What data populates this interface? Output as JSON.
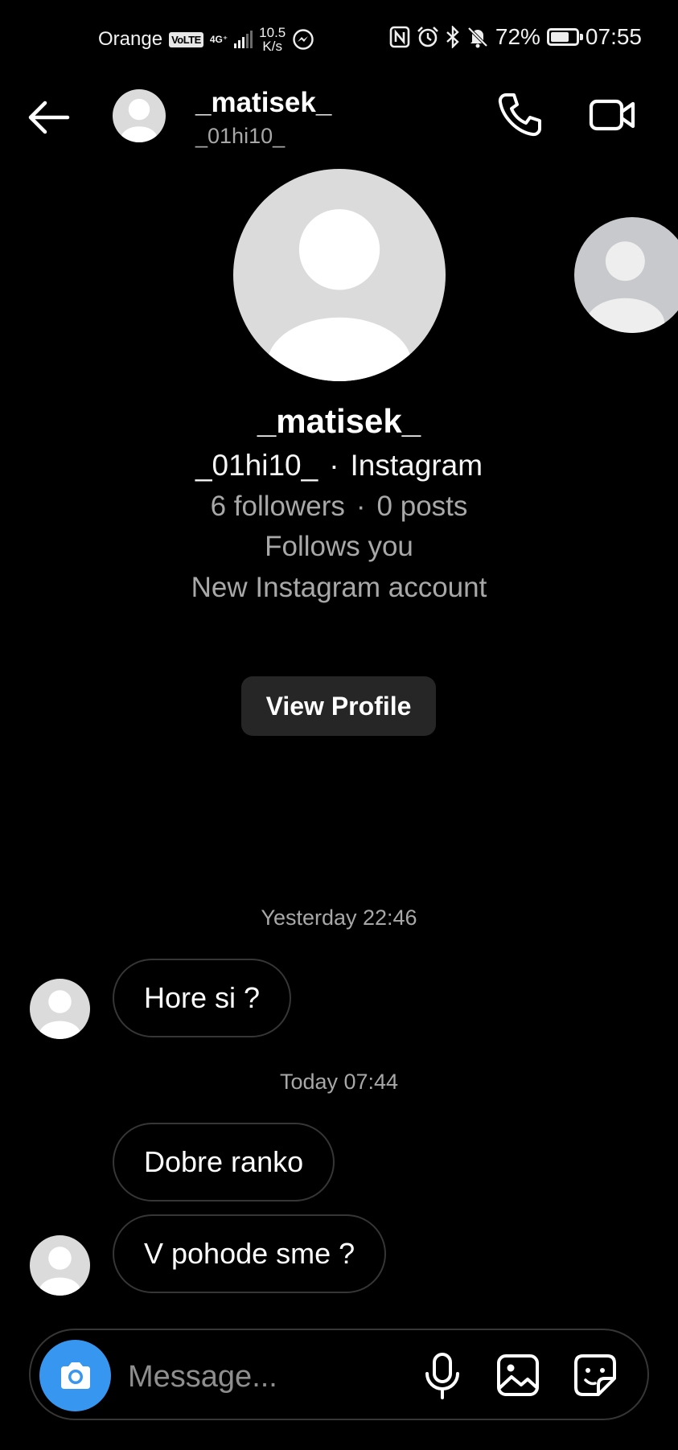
{
  "status_bar": {
    "carrier": "Orange",
    "volte": "VoLTE",
    "network": "4G⁺",
    "speed_value": "10.5",
    "speed_unit": "K/s",
    "battery": "72%",
    "battery_level": 0.72,
    "time": "07:55",
    "icons": [
      "messenger-icon",
      "nfc-icon",
      "alarm-icon",
      "bluetooth-icon",
      "mute-icon",
      "battery-icon"
    ]
  },
  "header": {
    "name": "_matisek_",
    "username": "_01hi10_",
    "icons": [
      "back-arrow-icon",
      "phone-icon",
      "video-camera-icon"
    ]
  },
  "profile": {
    "name": "_matisek_",
    "username": "_01hi10_",
    "platform": "Instagram",
    "followers": "6 followers",
    "posts": "0 posts",
    "follows_you": "Follows you",
    "new_account": "New Instagram account",
    "view_profile_label": "View Profile"
  },
  "messages": {
    "groups": [
      {
        "timestamp": "Yesterday 22:46",
        "items": [
          "Hore si ?"
        ]
      },
      {
        "timestamp": "Today 07:44",
        "items": [
          "Dobre ranko",
          "V pohode sme ?"
        ]
      }
    ]
  },
  "composer": {
    "placeholder": "Message...",
    "icons": [
      "camera-icon",
      "microphone-icon",
      "gallery-icon",
      "sticker-icon"
    ]
  },
  "colors": {
    "background": "#000000",
    "accent": "#3797f0",
    "secondary_text": "#a8a8a8",
    "bubble_border": "#363636",
    "button_bg": "#262626"
  }
}
